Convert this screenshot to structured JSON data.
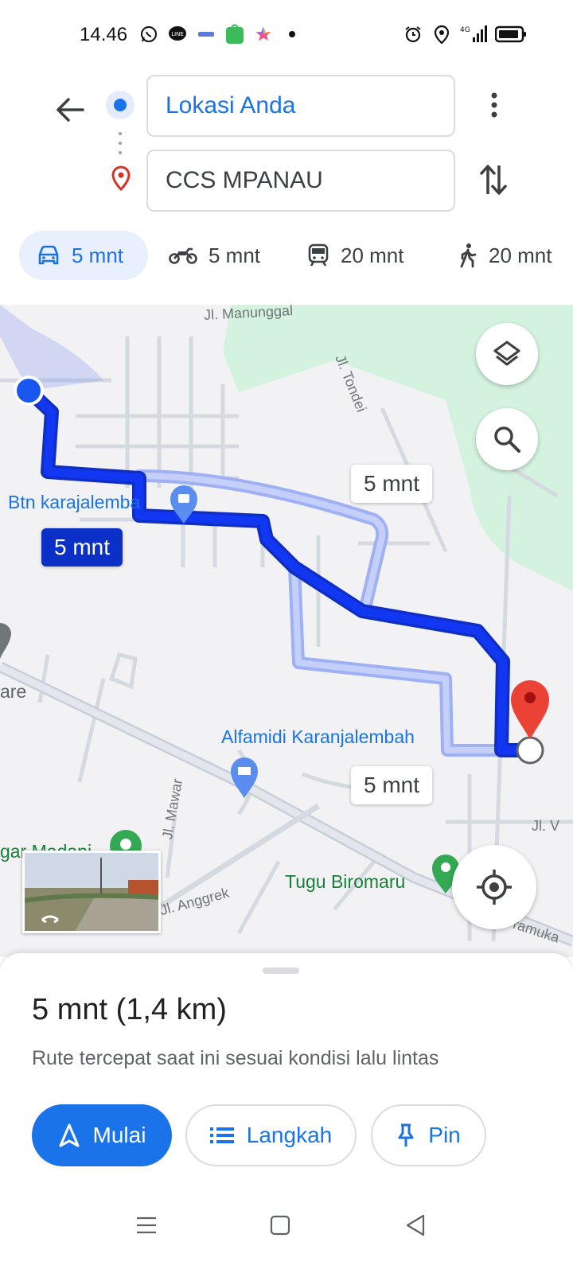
{
  "status_bar": {
    "time": "14.46",
    "left_icons": [
      "whatsapp-icon",
      "line-icon",
      "app-icon",
      "shopping-bag-icon",
      "star-app-icon",
      "notification-dot-icon"
    ],
    "right_icons": [
      "alarm-icon",
      "location-icon",
      "signal-4g-icon",
      "battery-icon"
    ],
    "network_label": "4G"
  },
  "header": {
    "origin_value": "Lokasi Anda",
    "destination_value": "CCS MPANAU"
  },
  "modes": [
    {
      "name": "car",
      "label": "5 mnt",
      "active": true
    },
    {
      "name": "motorcycle",
      "label": "5 mnt",
      "active": false
    },
    {
      "name": "transit",
      "label": "20 mnt",
      "active": false
    },
    {
      "name": "walk",
      "label": "20 mnt",
      "active": false
    }
  ],
  "map": {
    "poi": {
      "btn_karajalemba": "Btn karajalemba",
      "alfamidi": "Alfamidi Karanjalembah",
      "tugu": "Tugu Biromaru",
      "madani": "gar Madani",
      "are": "are"
    },
    "roads": {
      "manunggal": "Jl. Manunggal",
      "tondei": "Jl. Tondei",
      "mawar": "Jl. Mawar",
      "anggrek": "Jl. Anggrek",
      "pramuka": "Pramuka",
      "jl_v": "Jl. V"
    },
    "route_bubbles": {
      "primary": "5 mnt",
      "alt1": "5 mnt",
      "alt2": "5 mnt"
    },
    "colors": {
      "route_primary": "#1237f2",
      "route_alt": "#9fb0f5",
      "park": "#d4f3df",
      "destination_pin": "#ea4335"
    }
  },
  "sheet": {
    "summary": "5 mnt (1,4 km)",
    "subtitle": "Rute tercepat saat ini sesuai kondisi lalu lintas",
    "start_label": "Mulai",
    "steps_label": "Langkah",
    "pin_label": "Pin"
  }
}
